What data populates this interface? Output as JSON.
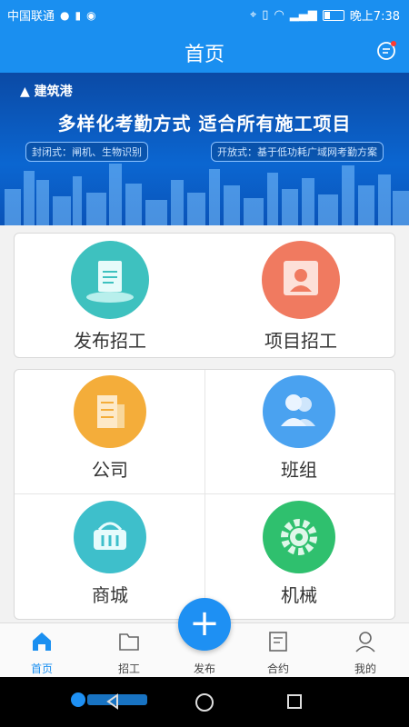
{
  "status_bar": {
    "carrier": "中国联通",
    "time": "晚上7:38"
  },
  "nav": {
    "title": "首页"
  },
  "banner": {
    "brand": "建筑港",
    "headline": "多样化考勤方式  适合所有施工项目",
    "left_note": "封闭式：闸机、生物识别",
    "right_note": "开放式：基于低功耗广域网考勤方案"
  },
  "grid_top": [
    {
      "label": "发布招工",
      "icon": "document-icon",
      "color": "#3ec1bf"
    },
    {
      "label": "项目招工",
      "icon": "person-card-icon",
      "color": "#f07a60"
    }
  ],
  "grid_bottom": [
    {
      "label": "公司",
      "icon": "building-icon",
      "color": "#f4ad3a"
    },
    {
      "label": "班组",
      "icon": "group-icon",
      "color": "#4aa2f0"
    },
    {
      "label": "商城",
      "icon": "basket-icon",
      "color": "#3ebfcb"
    },
    {
      "label": "机械",
      "icon": "gear-icon",
      "color": "#2fc06e"
    }
  ],
  "bottom_nav": [
    {
      "label": "首页",
      "icon": "home-icon",
      "active": true
    },
    {
      "label": "招工",
      "icon": "folder-icon",
      "active": false
    },
    {
      "label": "发布",
      "icon": "plus-icon",
      "active": false
    },
    {
      "label": "合约",
      "icon": "contract-icon",
      "active": false
    },
    {
      "label": "我的",
      "icon": "user-icon",
      "active": false
    }
  ],
  "colors": {
    "primary": "#1a8ff0",
    "active_tab": "#1a8ff0",
    "text": "#333333"
  }
}
